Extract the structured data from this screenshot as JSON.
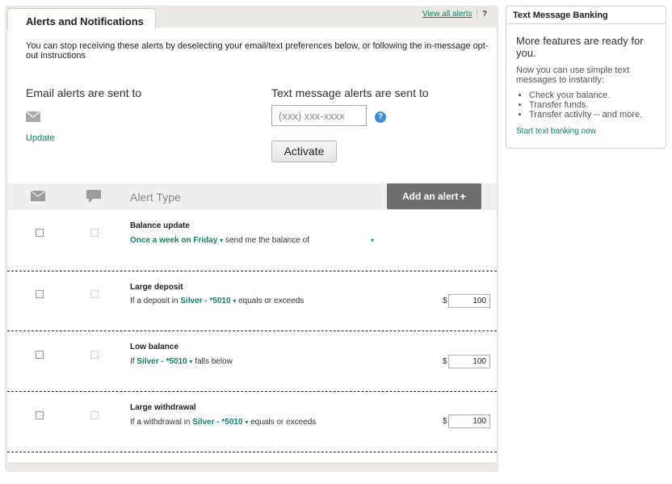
{
  "tab": {
    "label": "Alerts and Notifications"
  },
  "top_links": {
    "view_all": "View all alerts",
    "help": "?"
  },
  "intro": "You can stop receiving these alerts by deselecting your email/text preferences below, or following the in-message opt-out instructions",
  "email": {
    "label": "Email alerts are sent to",
    "update_link": "Update",
    "icon": "envelope-icon"
  },
  "text_message": {
    "label": "Text message alerts are sent to",
    "placeholder": "(xxx) xxx-xxxx",
    "value": "",
    "help": "?",
    "activate_label": "Activate"
  },
  "alerts_table": {
    "header": {
      "alert_type": "Alert Type",
      "add_alert": "Add an alert",
      "add_icon": "+"
    },
    "rows": [
      {
        "title": "Balance update",
        "desc": {
          "freq": "Once a week on Friday",
          "mid": "send me the balance of",
          "caret": "▾"
        }
      },
      {
        "title": "Large deposit",
        "desc": {
          "pre": "If a deposit in",
          "account": "Silver - *5010",
          "post": "equals or exceeds"
        },
        "currency": "$",
        "amount": "100"
      },
      {
        "title": "Low balance",
        "desc": {
          "pre": "If",
          "account": "Silver - *5010",
          "post": "falls below"
        },
        "currency": "$",
        "amount": "100"
      },
      {
        "title": "Large withdrawal",
        "desc": {
          "pre": "If a withdrawal in",
          "account": "Silver - *5010",
          "post": "equals or exceeds"
        },
        "currency": "$",
        "amount": "100"
      }
    ]
  },
  "side_panel": {
    "title": "Text Message Banking",
    "headline": "More features are ready for you.",
    "subtext": "Now you can use simple text messages to instantly:",
    "items": [
      "Check your balance.",
      "Transfer funds.",
      "Transfer activity -- and more."
    ],
    "link": "Start text banking now"
  },
  "colors": {
    "accent_green": "#14806b",
    "panel_bg": "#e9e8e2",
    "button_dark": "#6f6f6f"
  }
}
